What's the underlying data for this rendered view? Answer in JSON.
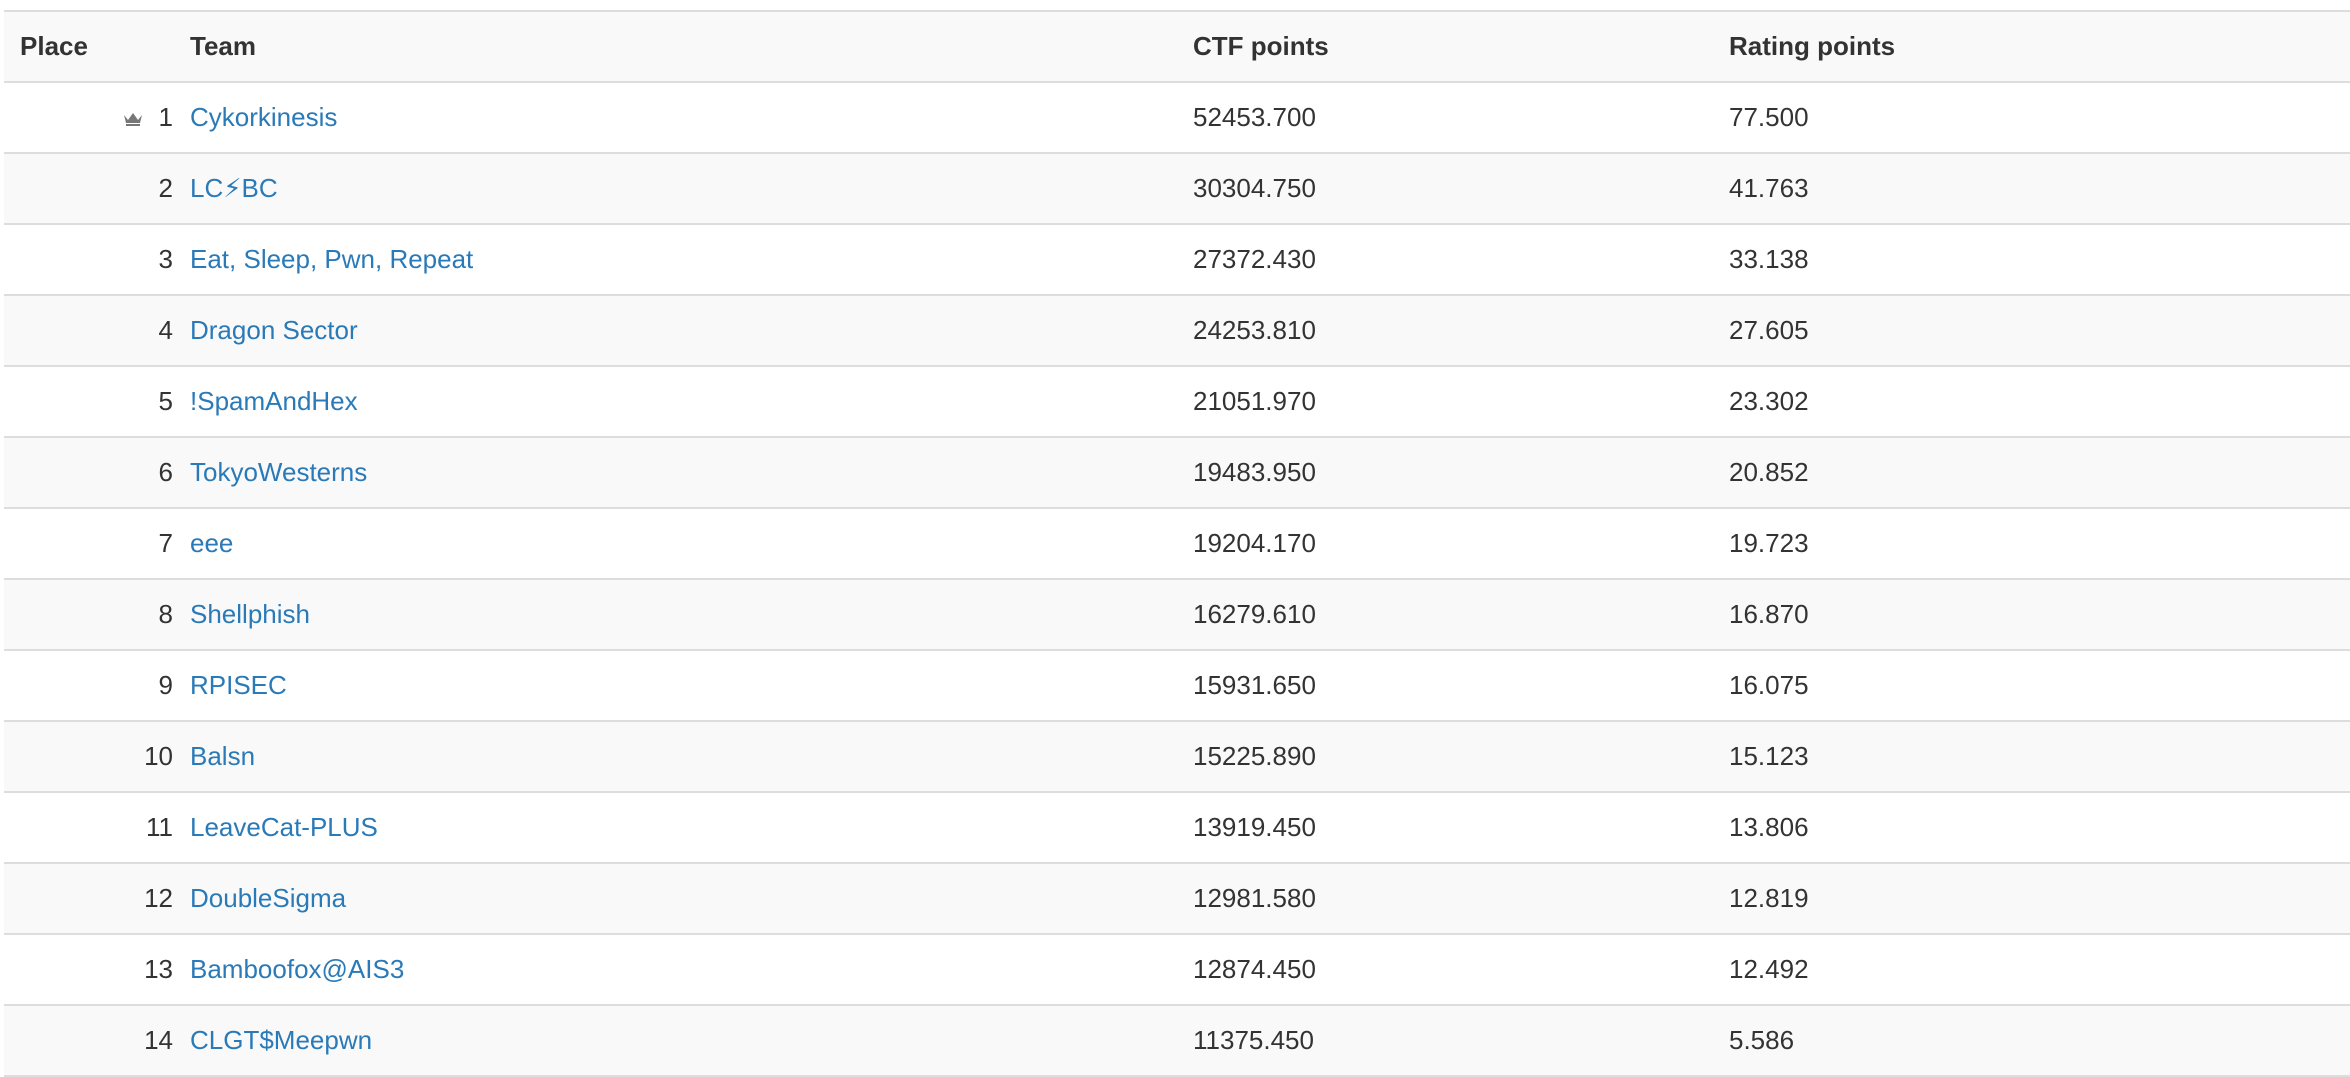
{
  "headers": {
    "place": "Place",
    "team": "Team",
    "ctf": "CTF points",
    "rating": "Rating points"
  },
  "colors": {
    "link": "#2a7ab8",
    "text": "#333333",
    "stripe": "#f9f9f9",
    "border": "#dddddd"
  },
  "rows": [
    {
      "place": "1",
      "team": "Cykorkinesis",
      "ctf": "52453.700",
      "rating": "77.500",
      "icon": "crown-icon"
    },
    {
      "place": "2",
      "team": "LC⚡BC",
      "ctf": "30304.750",
      "rating": "41.763"
    },
    {
      "place": "3",
      "team": "Eat, Sleep, Pwn, Repeat",
      "ctf": "27372.430",
      "rating": "33.138"
    },
    {
      "place": "4",
      "team": "Dragon Sector",
      "ctf": "24253.810",
      "rating": "27.605"
    },
    {
      "place": "5",
      "team": "!SpamAndHex",
      "ctf": "21051.970",
      "rating": "23.302"
    },
    {
      "place": "6",
      "team": "TokyoWesterns",
      "ctf": "19483.950",
      "rating": "20.852"
    },
    {
      "place": "7",
      "team": "eee",
      "ctf": "19204.170",
      "rating": "19.723"
    },
    {
      "place": "8",
      "team": "Shellphish",
      "ctf": "16279.610",
      "rating": "16.870"
    },
    {
      "place": "9",
      "team": "RPISEC",
      "ctf": "15931.650",
      "rating": "16.075"
    },
    {
      "place": "10",
      "team": "Balsn",
      "ctf": "15225.890",
      "rating": "15.123"
    },
    {
      "place": "11",
      "team": "LeaveCat-PLUS",
      "ctf": "13919.450",
      "rating": "13.806"
    },
    {
      "place": "12",
      "team": "DoubleSigma",
      "ctf": "12981.580",
      "rating": "12.819"
    },
    {
      "place": "13",
      "team": "Bamboofox@AIS3",
      "ctf": "12874.450",
      "rating": "12.492"
    },
    {
      "place": "14",
      "team": "CLGT$Meepwn",
      "ctf": "11375.450",
      "rating": "5.586"
    }
  ]
}
